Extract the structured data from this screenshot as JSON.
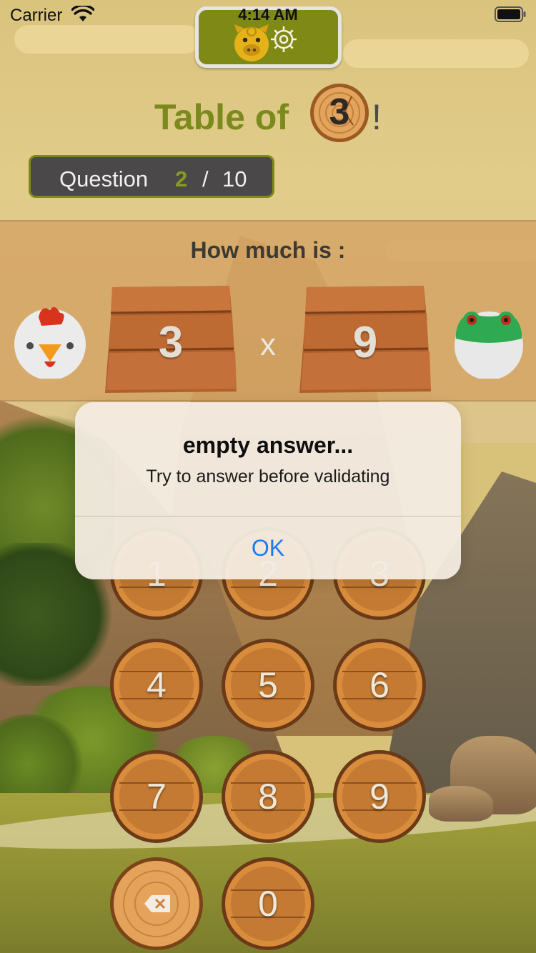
{
  "status_bar": {
    "carrier": "Carrier",
    "time": "4:14 AM",
    "icons": [
      "wifi-icon",
      "battery-icon"
    ]
  },
  "top_badge": {
    "icons": [
      "pig-icon",
      "gear-icon"
    ],
    "color": "#7f8a16"
  },
  "title": {
    "prefix": "Table of",
    "number": "3",
    "suffix": "!"
  },
  "counter": {
    "label": "Question",
    "current": "2",
    "separator": "/",
    "total": "10"
  },
  "question": {
    "heading": "How much is :",
    "left_operand": "3",
    "operator": "x",
    "right_operand": "9",
    "left_animal": "chicken-icon",
    "right_animal": "frog-icon"
  },
  "keypad": {
    "keys": [
      "1",
      "2",
      "3",
      "4",
      "5",
      "6",
      "7",
      "8",
      "9",
      "0"
    ],
    "delete_icon": "backspace-icon"
  },
  "alert": {
    "title": "empty answer...",
    "message": "Try to answer before validating",
    "ok_label": "OK",
    "ok_color": "#1a7cf5"
  }
}
